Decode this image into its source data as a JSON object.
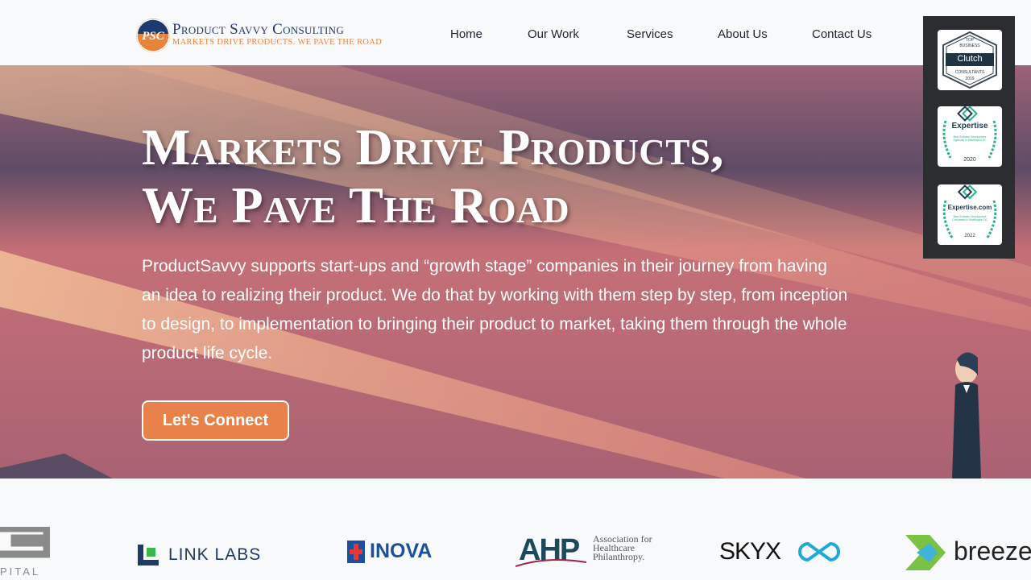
{
  "brand": {
    "title": "Product Savvy Consulting",
    "tagline": "MARKETS DRIVE PRODUCTS. WE PAVE THE ROAD",
    "mark": "PSC"
  },
  "nav": {
    "items": [
      {
        "label": "Home"
      },
      {
        "label": "Our Work"
      },
      {
        "label": "Services"
      },
      {
        "label": "About Us"
      },
      {
        "label": "Contact Us"
      }
    ]
  },
  "hero": {
    "title_line1": "Markets Drive Products,",
    "title_line2": "We Pave The Road",
    "description": "ProductSavvy supports start-ups and “growth stage” companies in their journey from having an idea to realizing their product. We do that by working with them step by step, from inception to design, to implementation to bringing their product to market, taking them through the whole product life cycle.",
    "cta_label": "Let's Connect"
  },
  "badges": [
    {
      "top": "TOP",
      "sub": "BUSINESS",
      "name": "Clutch",
      "cat": "CONSULTANTS",
      "year": "2019"
    },
    {
      "name": "Expertise",
      "desc": "Best Software Development Agencies in Washington DC",
      "year": "2020"
    },
    {
      "name": "Expertise.com",
      "desc": "Best Software Development Companies in Washington DC",
      "year": "2022"
    }
  ],
  "clients": {
    "partial_left": "PITAL",
    "link_labs": "LINK LABS",
    "inova": "INOVA",
    "ahp": "AHP",
    "ahp_line1": "Association for",
    "ahp_line2": "Healthcare",
    "ahp_line3": "Philanthropy.",
    "skyx": "SKYX",
    "breeze": "breeze"
  },
  "colors": {
    "brand_navy": "#1d3a6e",
    "brand_orange": "#e8833a",
    "cta": "#e8824a",
    "badge_panel": "#2b2d31"
  }
}
